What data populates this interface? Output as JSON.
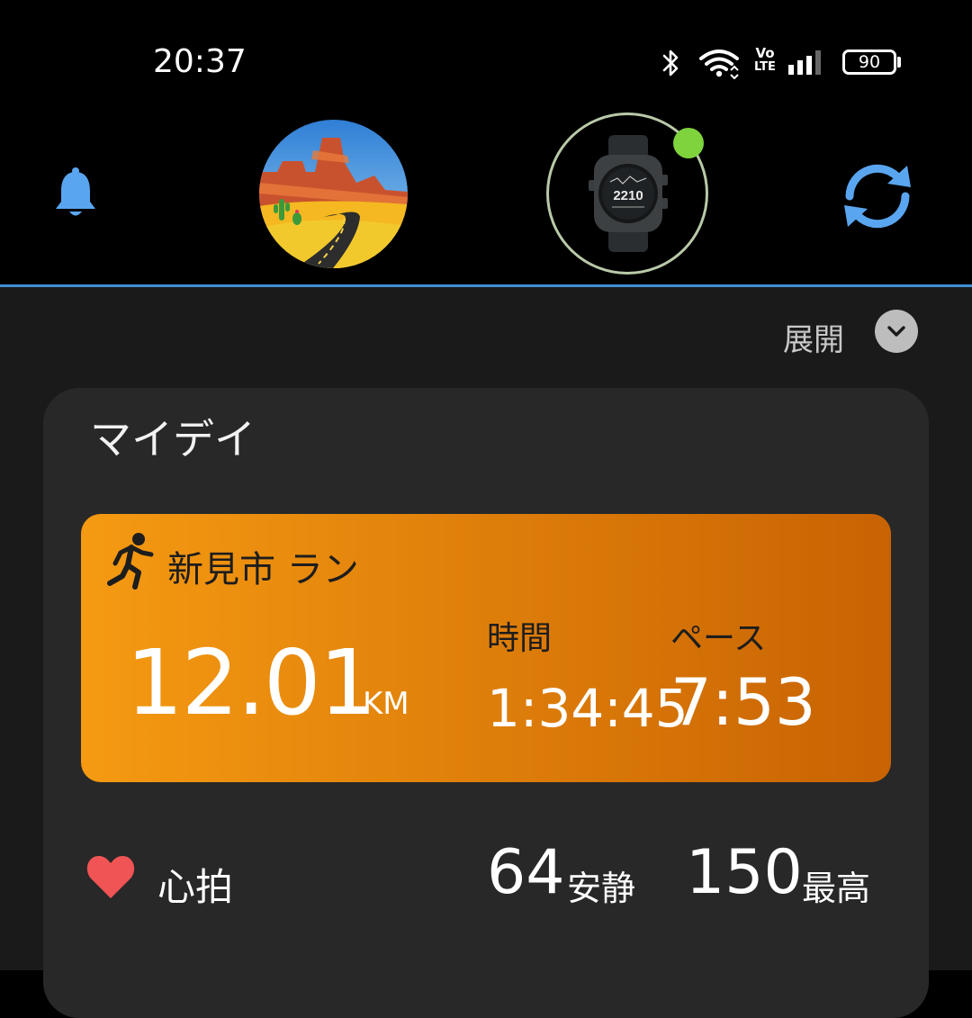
{
  "status_bar": {
    "time": "20:37",
    "battery": "90",
    "icons": [
      "bluetooth-icon",
      "wifi-icon",
      "volte-icon",
      "signal-icon",
      "battery-icon"
    ],
    "volte_text_top": "Vo",
    "volte_text_bottom": "LTE"
  },
  "header": {
    "icons": [
      "bell-icon",
      "avatar-desert-road",
      "watch-icon",
      "sync-icon"
    ],
    "watch_face_text": "2210",
    "device_status_color": "#7fd33d",
    "accent_color": "#3d8fd4"
  },
  "main": {
    "expand_label": "展開",
    "card_title": "マイデイ",
    "activity": {
      "name": "新見市 ラン",
      "distance": "12.01",
      "distance_unit": "KM",
      "time_label": "時間",
      "time": "1:34:45",
      "pace_label": "ペース",
      "pace": "7:53",
      "color_start": "#f59a12",
      "color_end": "#c86303"
    },
    "heart_rate": {
      "label": "心拍",
      "resting": "64",
      "resting_label": "安静",
      "max": "150",
      "max_label": "最高",
      "icon_color": "#f05454"
    }
  }
}
